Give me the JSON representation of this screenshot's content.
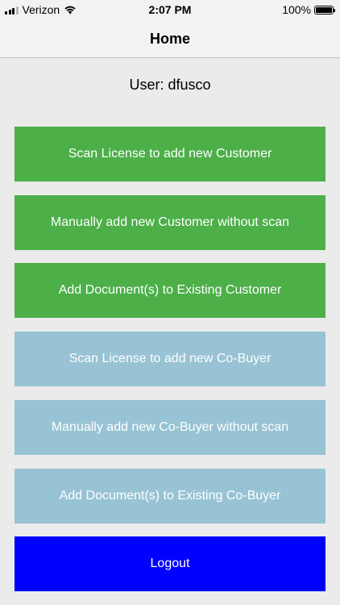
{
  "status_bar": {
    "carrier": "Verizon",
    "time": "2:07 PM",
    "battery_percent": "100%",
    "battery_level": 1.0
  },
  "nav": {
    "title": "Home"
  },
  "user": {
    "label": "User: dfusco"
  },
  "buttons": {
    "scan_customer": "Scan License to add new Customer",
    "manual_customer": "Manually add new Customer without scan",
    "doc_customer": "Add Document(s) to Existing Customer",
    "scan_cobuyer": "Scan License to add new Co-Buyer",
    "manual_cobuyer": "Manually add new Co-Buyer without scan",
    "doc_cobuyer": "Add Document(s) to Existing Co-Buyer",
    "logout": "Logout"
  },
  "colors": {
    "customer_button": "#4caf48",
    "cobuyer_button": "#98c3d4",
    "logout_button": "#0000ff"
  },
  "icons": [
    "cellular-signal-icon",
    "wifi-icon",
    "battery-icon"
  ]
}
